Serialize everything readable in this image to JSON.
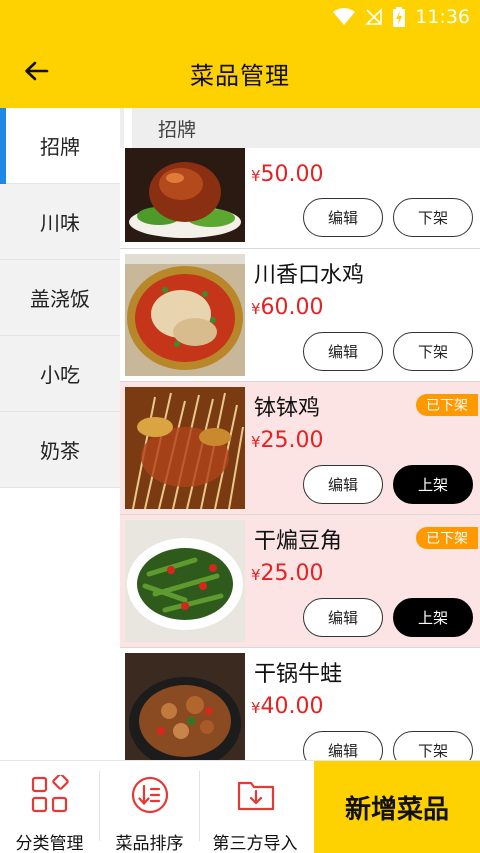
{
  "status_bar": {
    "time": "11:36"
  },
  "app_bar": {
    "title": "菜品管理"
  },
  "categories": [
    {
      "label": "招牌"
    },
    {
      "label": "川味"
    },
    {
      "label": "盖浇饭"
    },
    {
      "label": "小吃"
    },
    {
      "label": "奶茶"
    }
  ],
  "section": {
    "title": "招牌"
  },
  "currency": "¥",
  "dishes": [
    {
      "name": "",
      "price": "50.00",
      "status_badge": "",
      "edit_label": "编辑",
      "toggle_label": "下架"
    },
    {
      "name": "川香口水鸡",
      "price": "60.00",
      "status_badge": "",
      "edit_label": "编辑",
      "toggle_label": "下架"
    },
    {
      "name": "钵钵鸡",
      "price": "25.00",
      "status_badge": "已下架",
      "edit_label": "编辑",
      "toggle_label": "上架"
    },
    {
      "name": "干煸豆角",
      "price": "25.00",
      "status_badge": "已下架",
      "edit_label": "编辑",
      "toggle_label": "上架"
    },
    {
      "name": "干锅牛蛙",
      "price": "40.00",
      "status_badge": "",
      "edit_label": "编辑",
      "toggle_label": "下架"
    }
  ],
  "bottom_bar": {
    "tabs": [
      {
        "label": "分类管理",
        "icon": "category-grid-icon"
      },
      {
        "label": "菜品排序",
        "icon": "sort-icon"
      },
      {
        "label": "第三方导入",
        "icon": "folder-import-icon"
      }
    ],
    "add_label": "新增菜品"
  },
  "colors": {
    "accent": "#fed100",
    "price": "#e52222",
    "badge": "#ff9900",
    "active_indicator": "#1e88e5",
    "icon_red": "#e53935",
    "off_row_bg": "#fde4e4"
  }
}
